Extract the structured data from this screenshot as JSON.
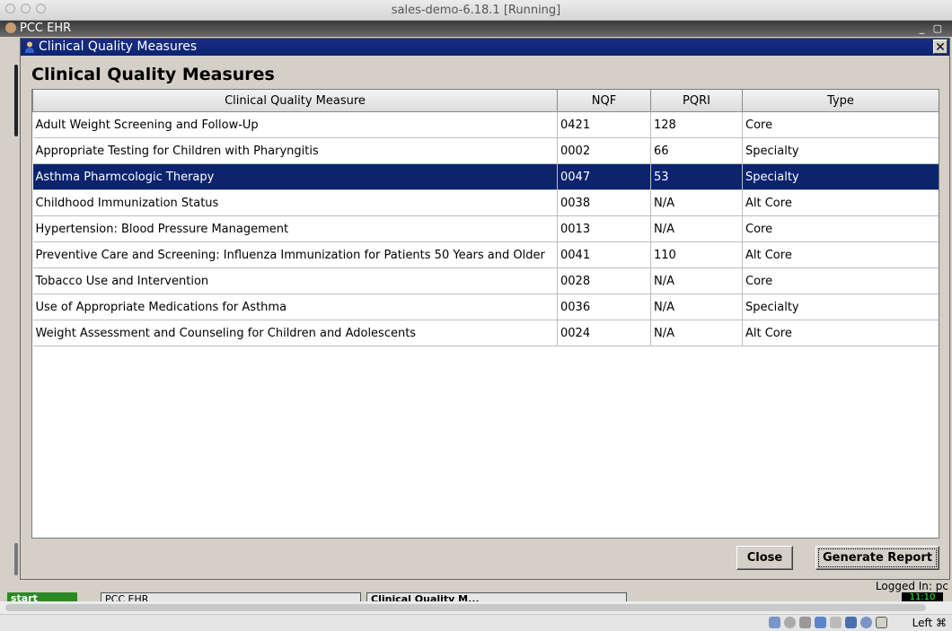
{
  "host_window": {
    "title": "sales-demo-6.18.1 [Running]"
  },
  "background_app": {
    "title": "PCC EHR"
  },
  "dialog": {
    "window_title": "Clinical Quality Measures",
    "heading": "Clinical Quality Measures",
    "close_glyph": "✕",
    "columns": [
      "Clinical Quality Measure",
      "NQF",
      "PQRI",
      "Type"
    ],
    "rows": [
      {
        "measure": "Adult Weight Screening and Follow-Up",
        "nqf": "0421",
        "pqri": "128",
        "type": "Core",
        "selected": false
      },
      {
        "measure": "Appropriate Testing for Children with Pharyngitis",
        "nqf": "0002",
        "pqri": "66",
        "type": "Specialty",
        "selected": false
      },
      {
        "measure": "Asthma Pharmcologic Therapy",
        "nqf": "0047",
        "pqri": "53",
        "type": "Specialty",
        "selected": true
      },
      {
        "measure": "Childhood Immunization Status",
        "nqf": "0038",
        "pqri": "N/A",
        "type": "Alt Core",
        "selected": false
      },
      {
        "measure": "Hypertension: Blood Pressure Management",
        "nqf": "0013",
        "pqri": "N/A",
        "type": "Core",
        "selected": false
      },
      {
        "measure": "Preventive Care and Screening: Influenza Immunization for Patients 50 Years and Older",
        "nqf": "0041",
        "pqri": "110",
        "type": "Alt Core",
        "selected": false
      },
      {
        "measure": "Tobacco Use and Intervention",
        "nqf": "0028",
        "pqri": "N/A",
        "type": "Core",
        "selected": false
      },
      {
        "measure": "Use of Appropriate Medications for Asthma",
        "nqf": "0036",
        "pqri": "N/A",
        "type": "Specialty",
        "selected": false
      },
      {
        "measure": "Weight Assessment and Counseling for Children and Adolescents",
        "nqf": "0024",
        "pqri": "N/A",
        "type": "Alt Core",
        "selected": false
      }
    ],
    "buttons": {
      "close": "Close",
      "generate": "Generate Report"
    }
  },
  "status": {
    "logged_in": "Logged In: pc"
  },
  "taskbar": {
    "start": "start",
    "task1": "PCC EHR",
    "task2": "Clinical Quality M...",
    "clock": "11:10"
  },
  "vm_statusbar": {
    "host_key": "Left ⌘"
  },
  "colors": {
    "selection": "#0c246e",
    "titlebar": "#0a2472"
  }
}
